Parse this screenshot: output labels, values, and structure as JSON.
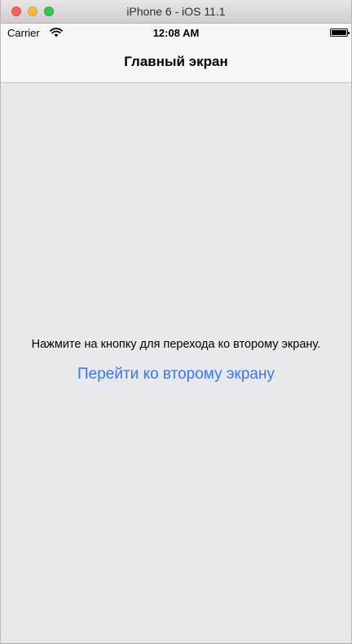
{
  "window": {
    "title": "iPhone 6 - iOS 11.1"
  },
  "status_bar": {
    "carrier": "Carrier",
    "time": "12:08 AM",
    "icons": [
      "wifi-icon",
      "battery-icon"
    ]
  },
  "nav_bar": {
    "title": "Главный экран"
  },
  "main": {
    "instruction": "Нажмите на кнопку для перехода ко второму экрану.",
    "button_label": "Перейти ко второму экрану"
  },
  "colors": {
    "accent": "#3478f6",
    "background": "#e9e8ed",
    "bar_background": "#f7f7f7"
  }
}
